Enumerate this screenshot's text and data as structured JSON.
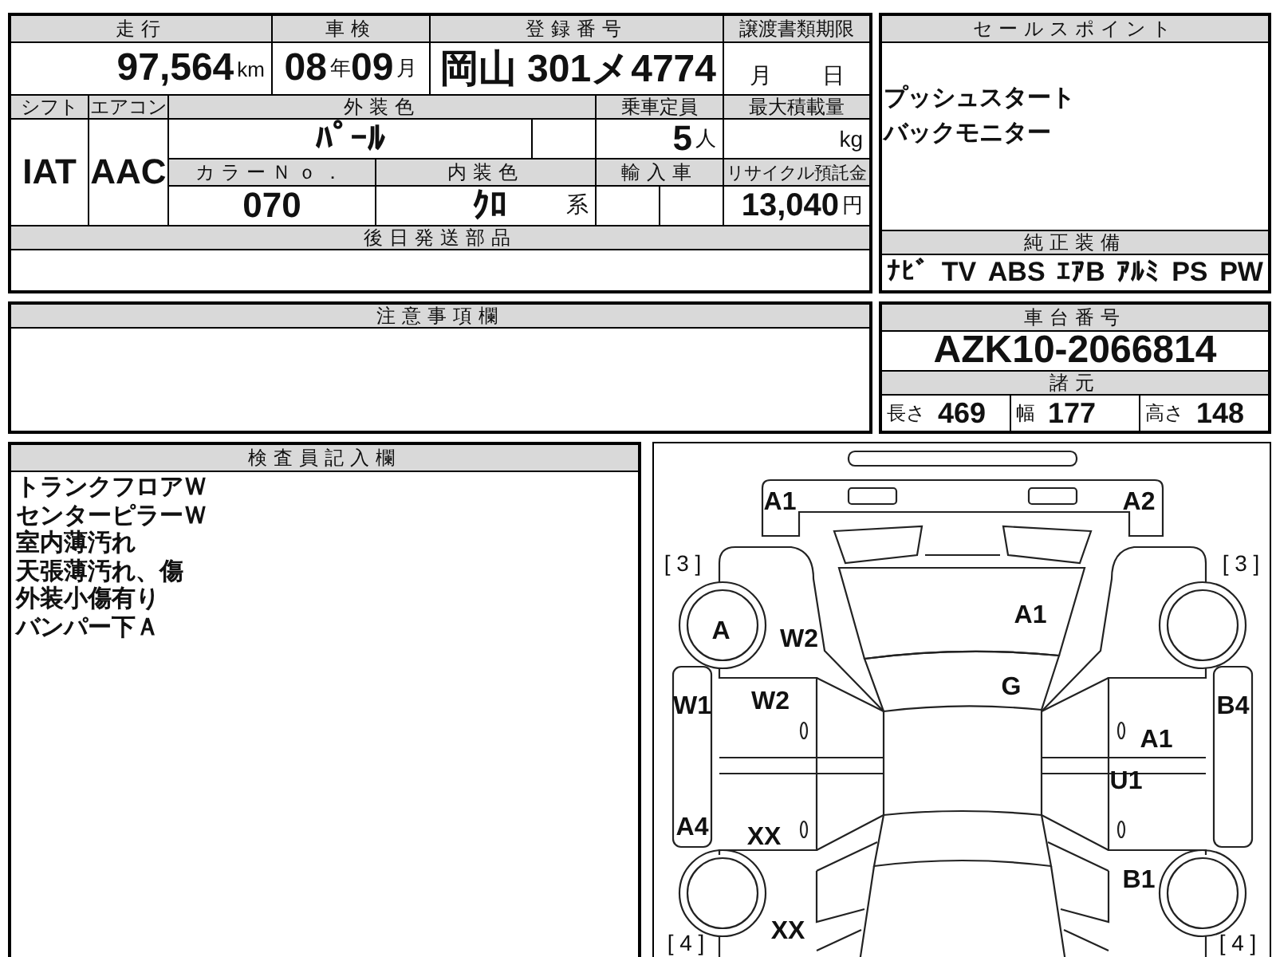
{
  "mileage": {
    "label": "走行",
    "value": "97,564",
    "unit": "km"
  },
  "inspection": {
    "label": "車検",
    "year": "08",
    "year_unit": "年",
    "month": "09",
    "month_unit": "月"
  },
  "registration": {
    "label": "登録番号",
    "value": "岡山 301メ4774"
  },
  "transfer_deadline": {
    "label": "譲渡書類期限",
    "month_unit": "月",
    "day_unit": "日"
  },
  "shift": {
    "label": "シフト",
    "value": "IAT"
  },
  "aircon": {
    "label": "エアコン",
    "value": "AAC"
  },
  "exterior_color": {
    "label": "外装色",
    "value": "ﾊﾟｰﾙ"
  },
  "capacity": {
    "label": "乗車定員",
    "value": "5",
    "unit": "人"
  },
  "max_load": {
    "label": "最大積載量",
    "unit": "kg"
  },
  "color_no": {
    "label": "カラーＮｏ．",
    "value": "070"
  },
  "interior_color": {
    "label": "内装色",
    "value": "ｸﾛ",
    "suffix": "系"
  },
  "imported": {
    "label": "輸入車"
  },
  "recycle_fee": {
    "label": "リサイクル預託金",
    "value": "13,040",
    "unit": "円"
  },
  "later_parts": {
    "label": "後日発送部品"
  },
  "sales_points": {
    "label": "セールスポイント",
    "items": [
      "プッシュスタート",
      "バックモニター"
    ]
  },
  "equipment": {
    "label": "純正装備",
    "items": [
      "ﾅﾋﾞ",
      "TV",
      "ABS",
      "ｴｱB",
      "ｱﾙﾐ",
      "PS",
      "PW"
    ]
  },
  "notes": {
    "label": "注意事項欄"
  },
  "chassis": {
    "label": "車台番号",
    "value": "AZK10-2066814"
  },
  "specs": {
    "label": "諸元",
    "dims": [
      {
        "label": "長さ",
        "value": "469"
      },
      {
        "label": "幅",
        "value": "177"
      },
      {
        "label": "高さ",
        "value": "148"
      }
    ]
  },
  "inspector_notes": {
    "label": "検査員記入欄",
    "lines": [
      "トランクフロアＷ",
      "センターピラーＷ",
      "室内薄汚れ",
      "天張薄汚れ、傷",
      "外装小傷有り",
      "バンパー下Ａ"
    ]
  },
  "diagram": {
    "marks": [
      {
        "kind": "damage",
        "text": "A1"
      },
      {
        "kind": "damage",
        "text": "A2"
      },
      {
        "kind": "tread",
        "text": "[ 3 ]"
      },
      {
        "kind": "tread",
        "text": "[ 3 ]"
      },
      {
        "kind": "damage",
        "text": "A"
      },
      {
        "kind": "damage",
        "text": "W2"
      },
      {
        "kind": "damage",
        "text": "A1"
      },
      {
        "kind": "damage",
        "text": "G"
      },
      {
        "kind": "damage",
        "text": "W1"
      },
      {
        "kind": "damage",
        "text": "W2"
      },
      {
        "kind": "damage",
        "text": "B4"
      },
      {
        "kind": "damage",
        "text": "A1"
      },
      {
        "kind": "damage",
        "text": "U1"
      },
      {
        "kind": "damage",
        "text": "A4"
      },
      {
        "kind": "damage",
        "text": "XX"
      },
      {
        "kind": "damage",
        "text": "B1"
      },
      {
        "kind": "damage",
        "text": "XX"
      },
      {
        "kind": "tread",
        "text": "[ 4 ]"
      },
      {
        "kind": "tread",
        "text": "[ 4 ]"
      }
    ]
  }
}
